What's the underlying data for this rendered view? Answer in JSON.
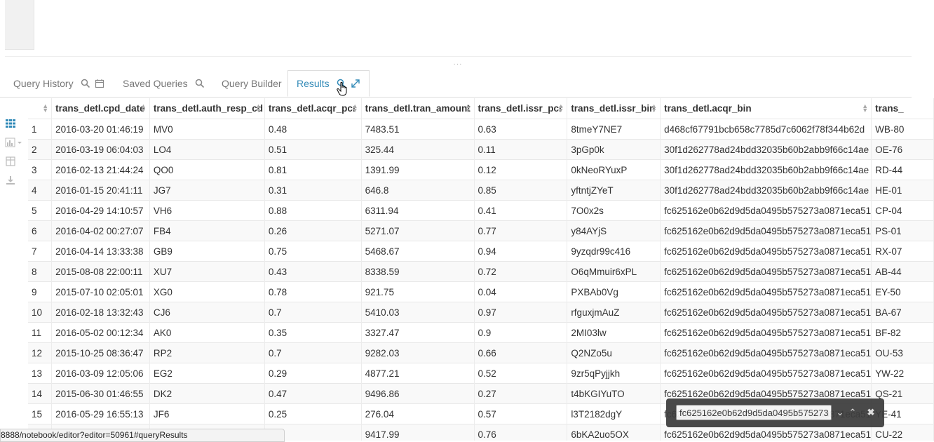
{
  "tabs": {
    "query_history": "Query History",
    "saved_queries": "Saved Queries",
    "query_builder": "Query Builder",
    "results": "Results"
  },
  "table": {
    "columns": [
      "",
      "trans_detl.cpd_date",
      "trans_detl.auth_resp_cd",
      "trans_detl.acqr_pcr",
      "trans_detl.tran_amount",
      "trans_detl.issr_pcr",
      "trans_detl.issr_bin",
      "trans_detl.acqr_bin",
      "trans_"
    ],
    "rows": [
      [
        "1",
        "2016-03-20 01:46:19",
        "MV0",
        "0.48",
        "7483.51",
        "0.63",
        "8tmeY7NE7",
        "d468cf67791bcb658c7785d7c6062f78f344b62d",
        "WB-80"
      ],
      [
        "2",
        "2016-03-19 06:04:03",
        "LO4",
        "0.51",
        "325.44",
        "0.11",
        "3pGp0k",
        "30f1d262778ad24bdd32035b60b2abb9f66c14ae",
        "OE-76"
      ],
      [
        "3",
        "2016-02-13 21:44:24",
        "QO0",
        "0.81",
        "1391.99",
        "0.12",
        "0kNeoRYuxP",
        "30f1d262778ad24bdd32035b60b2abb9f66c14ae",
        "RD-44"
      ],
      [
        "4",
        "2016-01-15 20:41:11",
        "JG7",
        "0.31",
        "646.8",
        "0.85",
        "yftntjZYeT",
        "30f1d262778ad24bdd32035b60b2abb9f66c14ae",
        "HE-01"
      ],
      [
        "5",
        "2016-04-29 14:10:57",
        "VH6",
        "0.88",
        "6311.94",
        "0.41",
        "7O0x2s",
        "fc625162e0b62d9d5da0495b575273a0871eca51",
        "CP-04"
      ],
      [
        "6",
        "2016-04-02 00:27:07",
        "FB4",
        "0.26",
        "5271.07",
        "0.77",
        "y84AYjS",
        "fc625162e0b62d9d5da0495b575273a0871eca51",
        "PS-01"
      ],
      [
        "7",
        "2016-04-14 13:33:38",
        "GB9",
        "0.75",
        "5468.67",
        "0.94",
        "9yzqdr99c416",
        "fc625162e0b62d9d5da0495b575273a0871eca51",
        "RX-07"
      ],
      [
        "8",
        "2015-08-08 22:00:11",
        "XU7",
        "0.43",
        "8338.59",
        "0.72",
        "O6qMmuir6xPL",
        "fc625162e0b62d9d5da0495b575273a0871eca51",
        "AB-44"
      ],
      [
        "9",
        "2015-07-10 02:05:01",
        "XG0",
        "0.78",
        "921.75",
        "0.04",
        "PXBAb0Vg",
        "fc625162e0b62d9d5da0495b575273a0871eca51",
        "EY-50"
      ],
      [
        "10",
        "2016-02-18 13:32:43",
        "CJ6",
        "0.7",
        "5410.03",
        "0.97",
        "rfguxjmAuZ",
        "fc625162e0b62d9d5da0495b575273a0871eca51",
        "BA-67"
      ],
      [
        "11",
        "2016-05-02 00:12:34",
        "AK0",
        "0.35",
        "3327.47",
        "0.9",
        "2MI03lw",
        "fc625162e0b62d9d5da0495b575273a0871eca51",
        "BF-82"
      ],
      [
        "12",
        "2015-10-25 08:36:47",
        "RP2",
        "0.7",
        "9282.03",
        "0.66",
        "Q2NZo5u",
        "fc625162e0b62d9d5da0495b575273a0871eca51",
        "OU-53"
      ],
      [
        "13",
        "2016-03-09 12:05:06",
        "EG2",
        "0.29",
        "4877.21",
        "0.52",
        "9zr5qPyjjkh",
        "fc625162e0b62d9d5da0495b575273a0871eca51",
        "YW-22"
      ],
      [
        "14",
        "2015-06-30 01:46:55",
        "DK2",
        "0.47",
        "9496.86",
        "0.27",
        "t4bKGIYuTO",
        "fc625162e0b62d9d5da0495b575273a0871eca51",
        "QS-21"
      ],
      [
        "15",
        "2016-05-29 16:55:13",
        "JF6",
        "0.25",
        "276.04",
        "0.57",
        "l3T2182dgY",
        "fc625162e0b62d9d5da0495b575273a0871eca51",
        "YE-41"
      ],
      [
        "",
        "",
        "",
        "",
        "9417.99",
        "0.76",
        "6bKA2uo5OX",
        "fc625162e0b62d9d5da0495b575273a0871eca51",
        "CU-22"
      ]
    ]
  },
  "statusbar": {
    "url": "8888/notebook/editor?editor=50961#queryResults"
  },
  "findbar": {
    "value": "fc625162e0b62d9d5da0495b575273a0871eca51"
  },
  "colors": {
    "accent": "#338bb8",
    "muted": "#777777"
  }
}
